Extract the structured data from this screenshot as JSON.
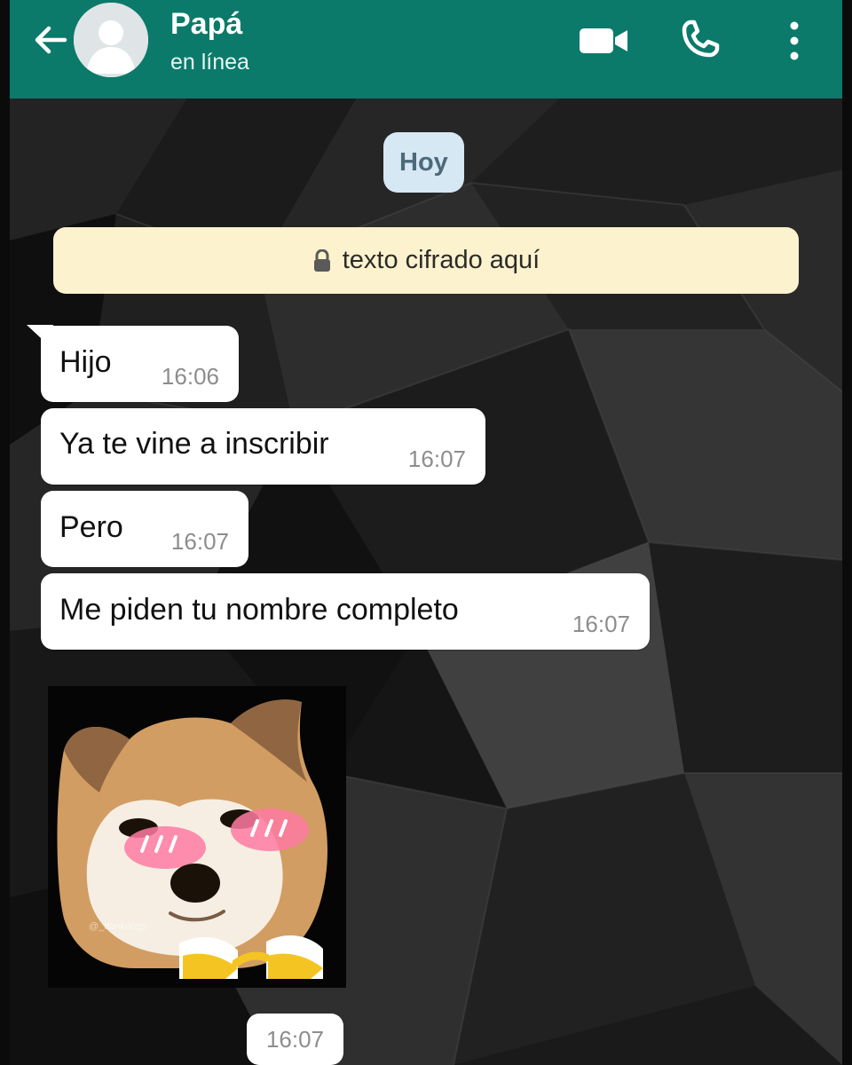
{
  "header": {
    "contact_name": "Papá",
    "status": "en línea",
    "icons": [
      "back-arrow-icon",
      "avatar-icon",
      "video-call-icon",
      "phone-call-icon",
      "more-options-icon"
    ],
    "background_color": "#0b7a6a"
  },
  "chat": {
    "date_label": "Hoy",
    "encryption_notice": "texto cifrado aquí",
    "messages": [
      {
        "text": "Hijo",
        "time": "16:06"
      },
      {
        "text": "Ya te vine a inscribir",
        "time": "16:07"
      },
      {
        "text": "Pero",
        "time": "16:07"
      },
      {
        "text": "Me piden tu nombre completo",
        "time": "16:07"
      }
    ],
    "sticker": {
      "description_icon": "blushing-shiba-dog-sticker",
      "watermark": "@_dankdogs",
      "time": "16:07"
    }
  },
  "colors": {
    "bubble": "#ffffff",
    "date_pill": "#d6e8f4",
    "encryption_banner": "#fcf2cd",
    "time_text": "#8d8d8d"
  }
}
